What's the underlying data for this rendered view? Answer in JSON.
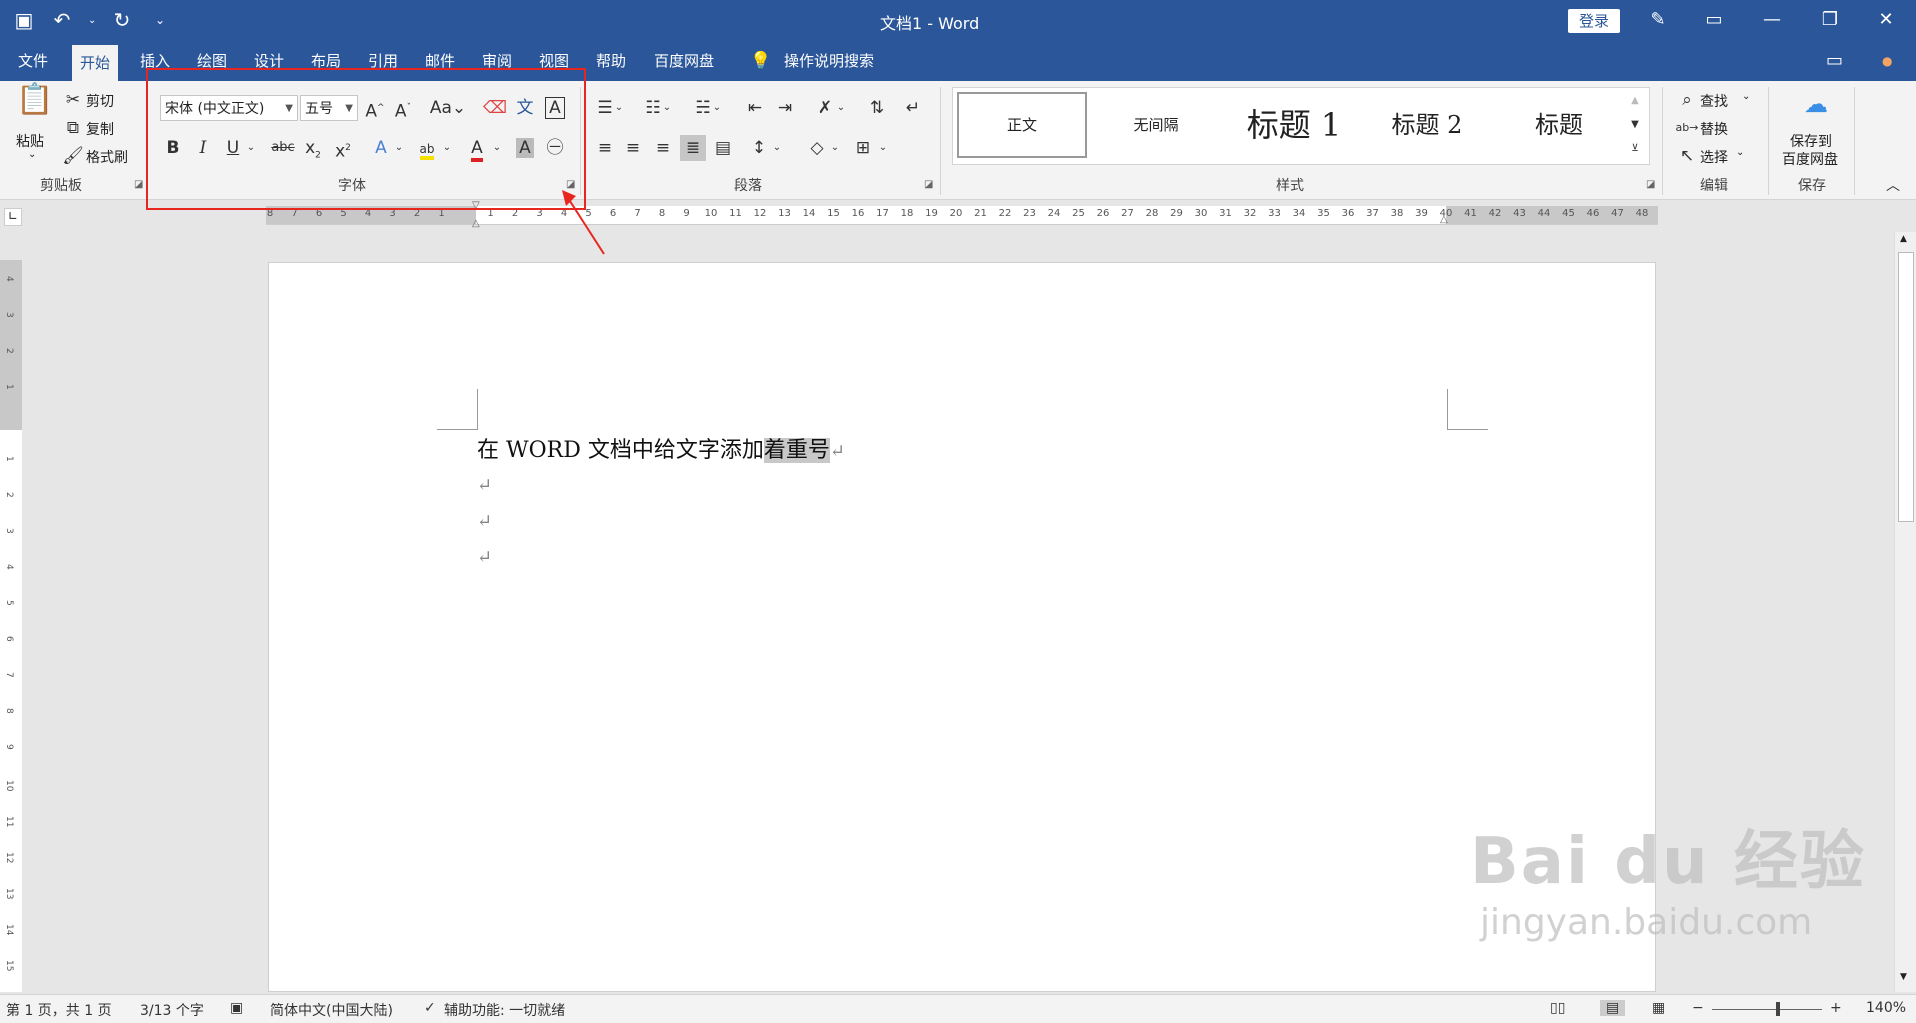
{
  "titlebar": {
    "title": "文档1 - Word",
    "login_label": "登录",
    "qat": [
      {
        "name": "save-icon",
        "glyph": "🖫"
      },
      {
        "name": "undo-icon",
        "glyph": "↶"
      },
      {
        "name": "redo-icon",
        "glyph": "↻"
      },
      {
        "name": "customize-qat-icon",
        "glyph": "⌄"
      }
    ]
  },
  "tabs": [
    "文件",
    "开始",
    "插入",
    "绘图",
    "设计",
    "布局",
    "引用",
    "邮件",
    "审阅",
    "视图",
    "帮助",
    "百度网盘"
  ],
  "active_tab": "开始",
  "tell_me": "操作说明搜索",
  "clipboard": {
    "paste": "粘贴",
    "cut": "剪切",
    "copy": "复制",
    "format_painter": "格式刷",
    "label": "剪贴板"
  },
  "font": {
    "name": "宋体 (中文正文)",
    "size": "五号",
    "label": "字体"
  },
  "paragraph": {
    "label": "段落"
  },
  "styles": {
    "items": [
      "正文",
      "无间隔",
      "标题 1",
      "标题 2",
      "标题"
    ],
    "label": "样式"
  },
  "editing": {
    "find": "查找",
    "replace": "替换",
    "select": "选择",
    "label": "编辑"
  },
  "save_group": {
    "button_line1": "保存到",
    "button_line2": "百度网盘",
    "label": "保存"
  },
  "ruler": {
    "ticks": [
      "8",
      "7",
      "6",
      "5",
      "4",
      "3",
      "2",
      "1",
      "",
      "1",
      "2",
      "3",
      "4",
      "5",
      "6",
      "7",
      "8",
      "9",
      "10",
      "11",
      "12",
      "13",
      "14",
      "15",
      "16",
      "17",
      "18",
      "19",
      "20",
      "21",
      "22",
      "23",
      "24",
      "25",
      "26",
      "27",
      "28",
      "29",
      "30",
      "31",
      "32",
      "33",
      "34",
      "35",
      "36",
      "37",
      "38",
      "39",
      "40",
      "41",
      "42",
      "43",
      "44",
      "45",
      "46",
      "47",
      "48"
    ],
    "v_ticks": [
      "4",
      "3",
      "2",
      "1",
      "",
      "1",
      "2",
      "3",
      "4",
      "5",
      "6",
      "7",
      "8",
      "9",
      "10",
      "11",
      "12",
      "13",
      "14",
      "15"
    ]
  },
  "document": {
    "line1_plain": "在 WORD 文档中给文字添加",
    "line1_selected": "着重号",
    "para_mark": "↵"
  },
  "status": {
    "page": "第 1 页，共 1 页",
    "words": "3/13 个字",
    "language": "简体中文(中国大陆)",
    "accessibility": "辅助功能: 一切就绪",
    "zoom": "140%"
  },
  "watermark": {
    "brand": "Bai du 经验",
    "url": "jingyan.baidu.com"
  },
  "colors": {
    "brand_blue": "#2b579a",
    "annotation_red": "#e8261f",
    "font_color_red": "#e02020",
    "highlight_yellow": "#f5e100"
  }
}
